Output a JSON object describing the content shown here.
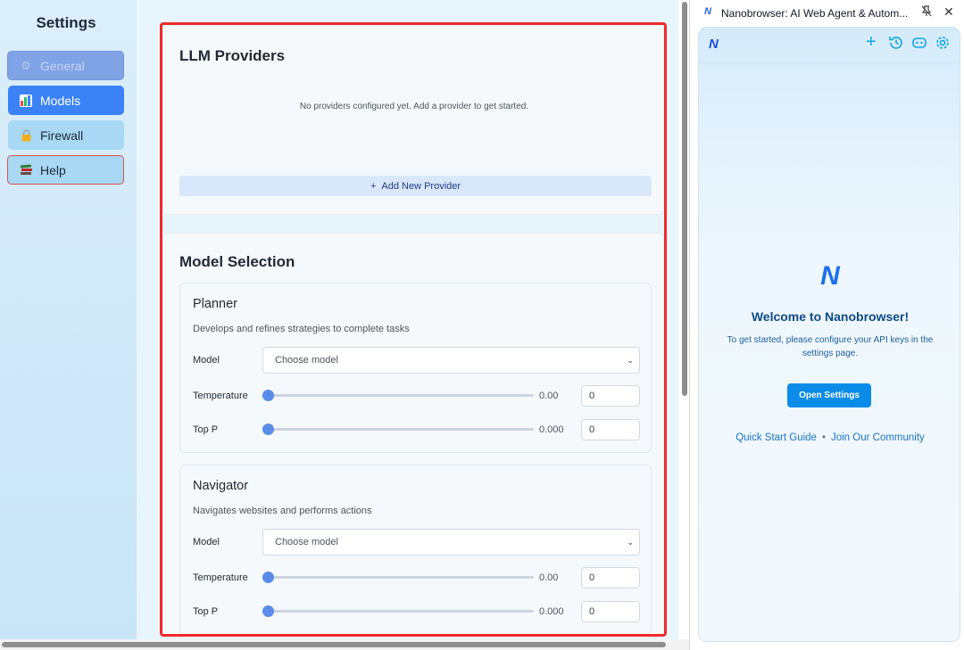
{
  "sidebar": {
    "title": "Settings",
    "items": [
      {
        "label": "General",
        "icon": "gear-icon"
      },
      {
        "label": "Models",
        "icon": "bar-chart-icon"
      },
      {
        "label": "Firewall",
        "icon": "lock-icon"
      },
      {
        "label": "Help",
        "icon": "books-icon"
      }
    ]
  },
  "providers": {
    "title": "LLM Providers",
    "empty_message": "No providers configured yet. Add a provider to get started.",
    "add_button": "Add New Provider",
    "add_icon": "+"
  },
  "model_selection": {
    "title": "Model Selection",
    "agents": [
      {
        "name": "Planner",
        "description": "Develops and refines strategies to complete tasks",
        "model_label": "Model",
        "model_placeholder": "Choose model",
        "temperature_label": "Temperature",
        "temperature_value": "0.00",
        "temperature_input": "0",
        "top_p_label": "Top P",
        "top_p_value": "0.000",
        "top_p_input": "0"
      },
      {
        "name": "Navigator",
        "description": "Navigates websites and performs actions",
        "model_label": "Model",
        "model_placeholder": "Choose model",
        "temperature_label": "Temperature",
        "temperature_value": "0.00",
        "temperature_input": "0",
        "top_p_label": "Top P",
        "top_p_value": "0.000",
        "top_p_input": "0"
      }
    ]
  },
  "side_panel": {
    "tab_title": "Nanobrowser: AI Web Agent & Autom...",
    "logo": "N",
    "welcome_title": "Welcome to Nanobrowser!",
    "welcome_text": "To get started, please configure your API keys in the settings page.",
    "open_settings": "Open Settings",
    "link_quick_start": "Quick Start Guide",
    "link_separator": "•",
    "link_community": "Join Our Community"
  },
  "colors": {
    "accent": "#3b82f6",
    "highlight_border": "#ee2b2b",
    "open_settings_button": "#0c8ce9"
  }
}
